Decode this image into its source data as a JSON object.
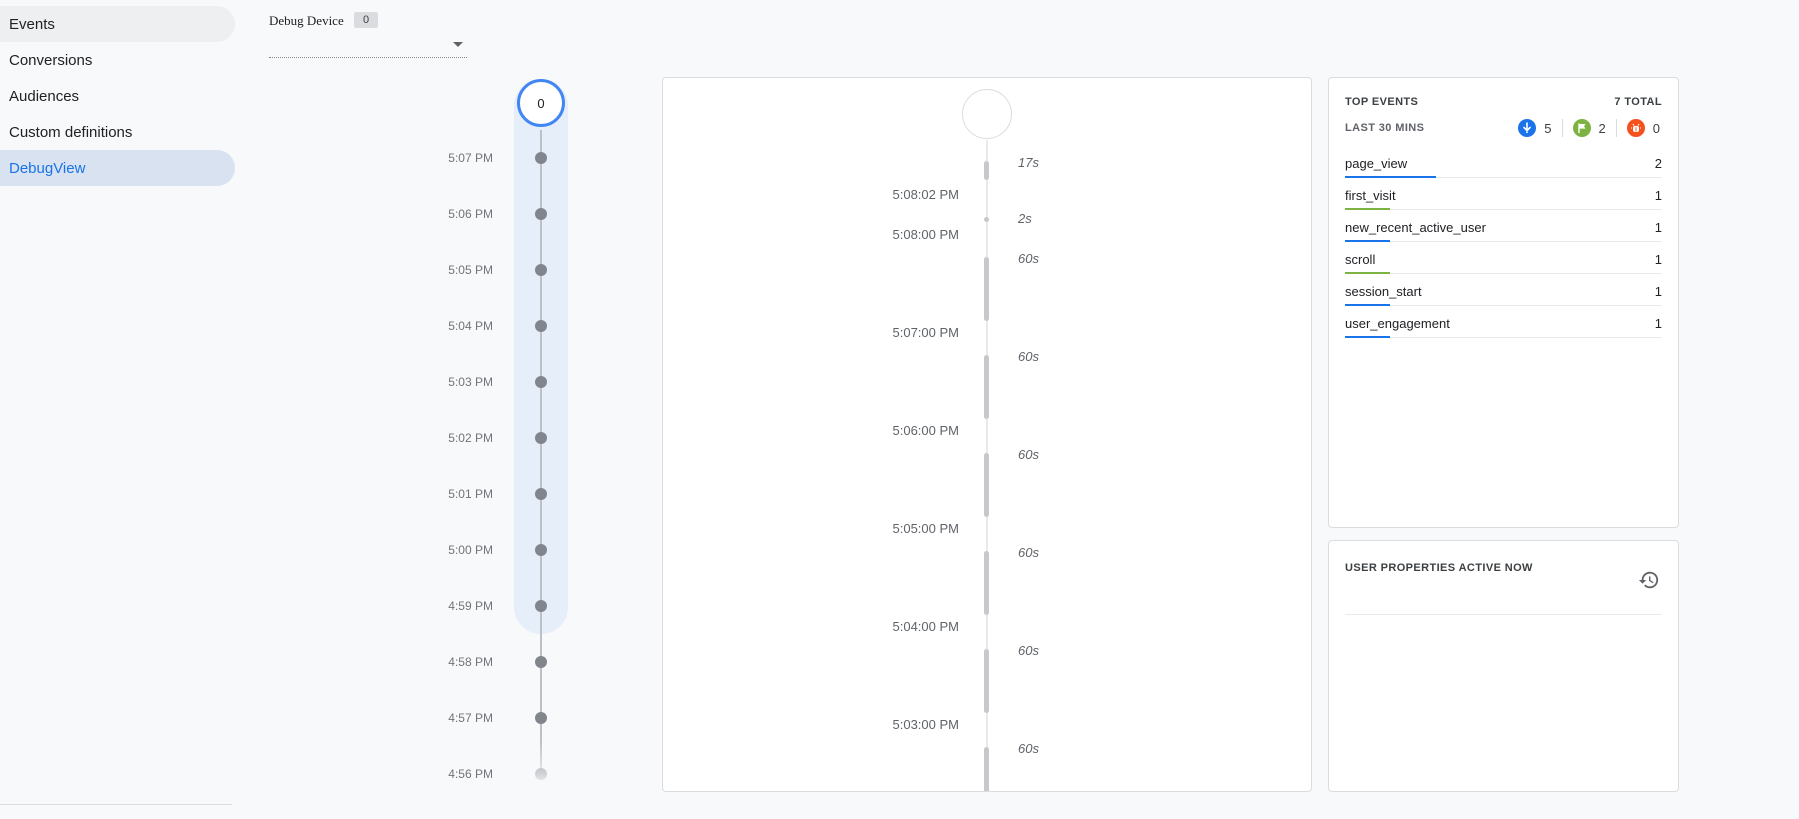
{
  "sidebar": {
    "items": [
      {
        "label": "Events"
      },
      {
        "label": "Conversions"
      },
      {
        "label": "Audiences"
      },
      {
        "label": "Custom definitions"
      },
      {
        "label": "DebugView"
      }
    ]
  },
  "device": {
    "label": "Debug Device",
    "count": "0"
  },
  "minute_timeline": {
    "top_count": "0",
    "labels": [
      "5:07 PM",
      "5:06 PM",
      "5:05 PM",
      "5:04 PM",
      "5:03 PM",
      "5:02 PM",
      "5:01 PM",
      "5:00 PM",
      "4:59 PM",
      "4:58 PM",
      "4:57 PM",
      "4:56 PM"
    ]
  },
  "seconds_timeline": {
    "gaps": [
      "17s",
      "2s",
      "60s",
      "60s",
      "60s",
      "60s",
      "60s",
      "60s"
    ],
    "times": [
      "5:08:02 PM",
      "5:08:00 PM",
      "5:07:00 PM",
      "5:06:00 PM",
      "5:05:00 PM",
      "5:04:00 PM",
      "5:03:00 PM"
    ]
  },
  "top_events": {
    "title": "TOP EVENTS",
    "total": "7 TOTAL",
    "subtitle": "LAST 30 MINS",
    "counts": [
      {
        "icon": "event-icon",
        "value": "5",
        "color": "#1a73e8"
      },
      {
        "icon": "conversion-flag-icon",
        "value": "2",
        "color": "#7cb342"
      },
      {
        "icon": "error-icon",
        "value": "0",
        "color": "#f4511e"
      }
    ],
    "events": [
      {
        "name": "page_view",
        "count": "2",
        "bar_color": "#1a73e8",
        "share": 0.286
      },
      {
        "name": "first_visit",
        "count": "1",
        "bar_color": "#7cb342",
        "share": 0.143
      },
      {
        "name": "new_recent_active_user",
        "count": "1",
        "bar_color": "#1a73e8",
        "share": 0.143
      },
      {
        "name": "scroll",
        "count": "1",
        "bar_color": "#7cb342",
        "share": 0.143
      },
      {
        "name": "session_start",
        "count": "1",
        "bar_color": "#1a73e8",
        "share": 0.143
      },
      {
        "name": "user_engagement",
        "count": "1",
        "bar_color": "#1a73e8",
        "share": 0.143
      }
    ]
  },
  "user_properties": {
    "title": "USER PROPERTIES ACTIVE NOW"
  }
}
